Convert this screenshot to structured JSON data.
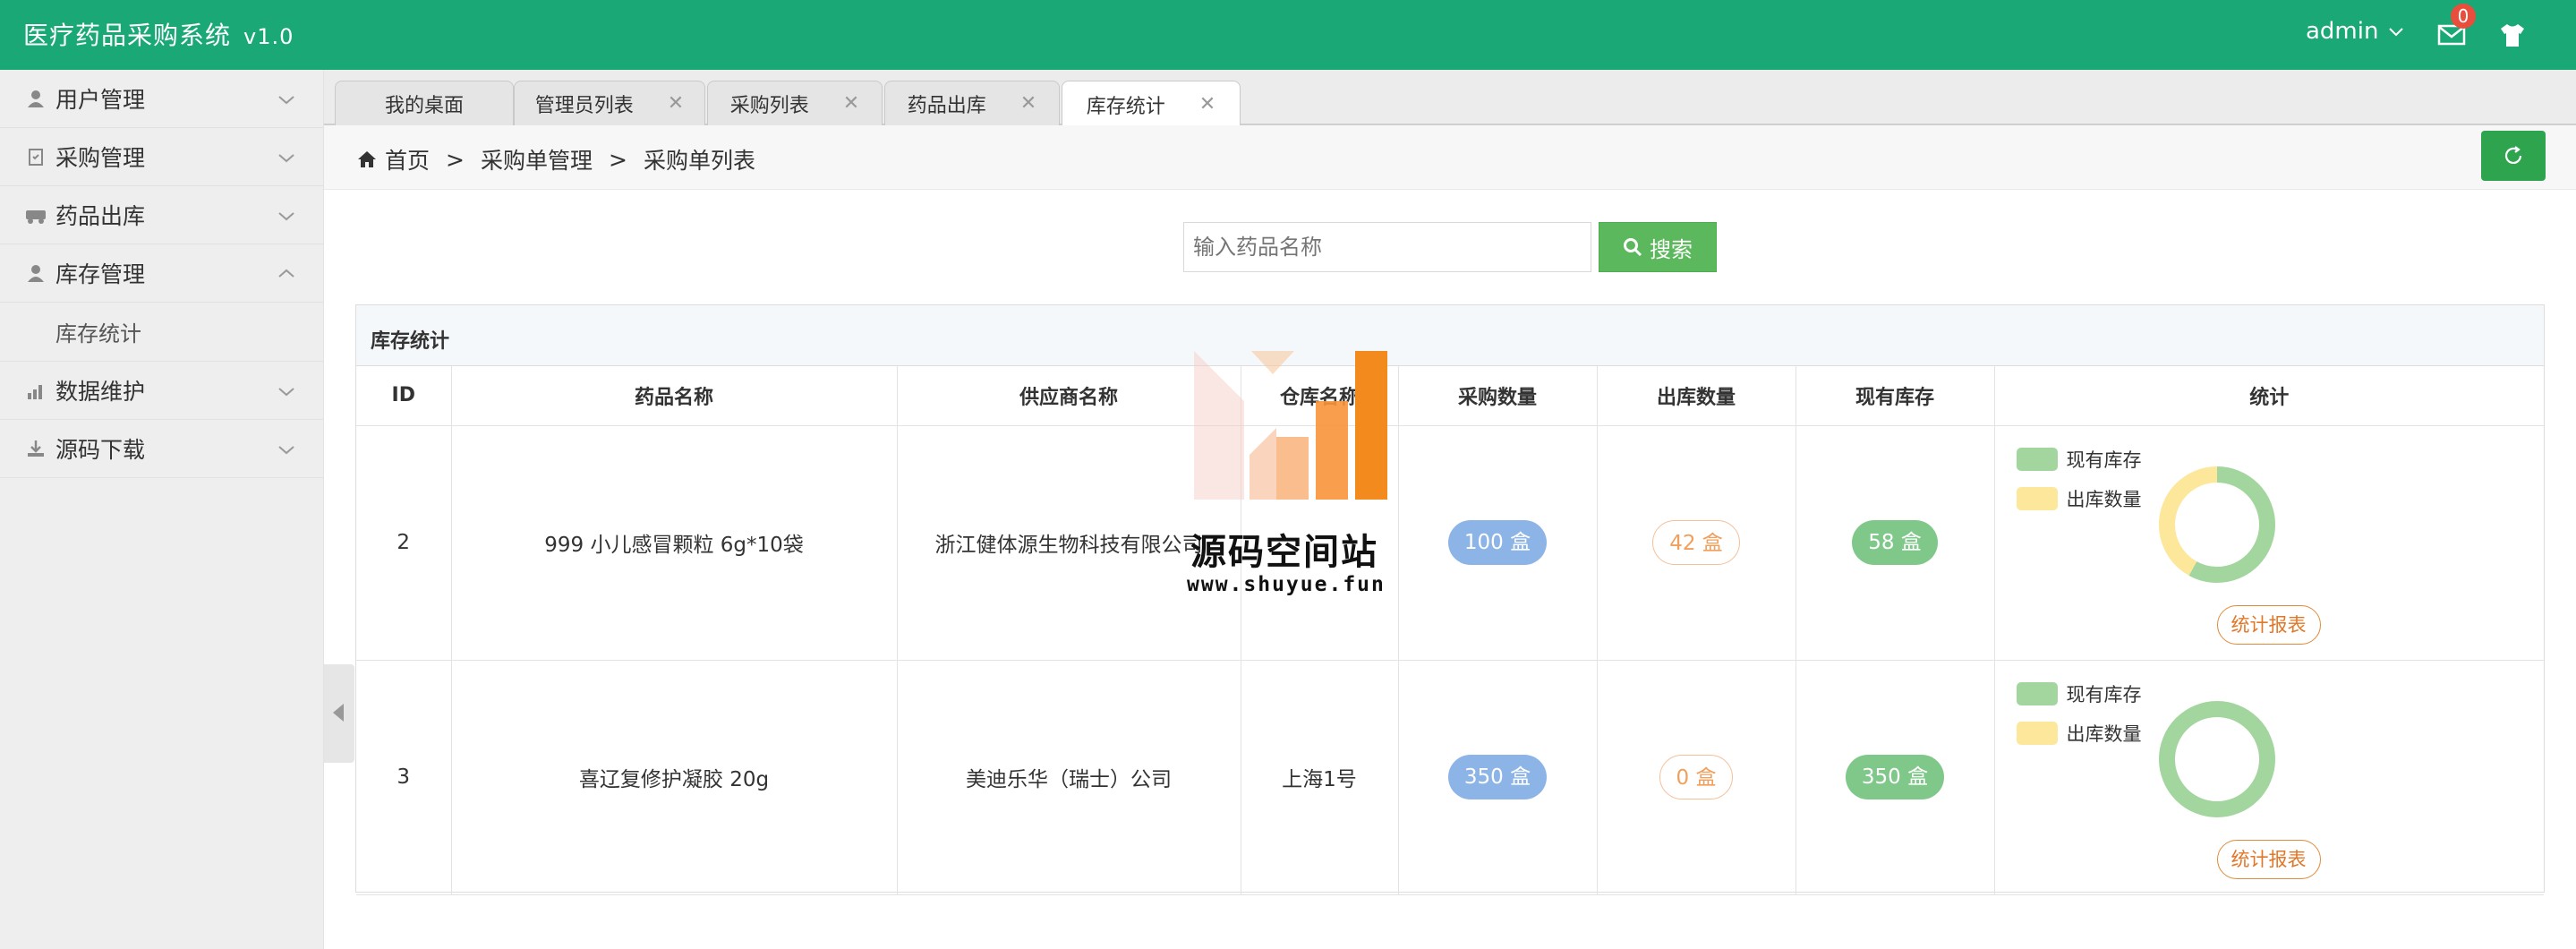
{
  "app": {
    "title": "医疗药品采购系统",
    "version": "v1.0"
  },
  "header": {
    "user": "admin",
    "mail_count": "0"
  },
  "sidebar": {
    "items": [
      {
        "label": "用户管理",
        "icon": "user-icon",
        "expanded": false
      },
      {
        "label": "采购管理",
        "icon": "clipboard-icon",
        "expanded": false
      },
      {
        "label": "药品出库",
        "icon": "truck-icon",
        "expanded": false
      },
      {
        "label": "库存管理",
        "icon": "user-icon",
        "expanded": true
      },
      {
        "label": "数据维护",
        "icon": "bar-chart-icon",
        "expanded": false
      },
      {
        "label": "源码下载",
        "icon": "download-icon",
        "expanded": false
      }
    ],
    "sub_items": [
      {
        "label": "库存统计"
      }
    ]
  },
  "tabs": [
    {
      "label": "我的桌面",
      "closable": false
    },
    {
      "label": "管理员列表",
      "closable": true
    },
    {
      "label": "采购列表",
      "closable": true
    },
    {
      "label": "药品出库",
      "closable": true
    },
    {
      "label": "库存统计",
      "closable": true,
      "active": true
    }
  ],
  "breadcrumb": [
    "首页",
    "采购单管理",
    "采购单列表"
  ],
  "breadcrumb_sep": ">",
  "search": {
    "placeholder": "输入药品名称",
    "button_label": "搜索"
  },
  "panel": {
    "title": "库存统计"
  },
  "table": {
    "columns": [
      "ID",
      "药品名称",
      "供应商名称",
      "仓库名称",
      "采购数量",
      "出库数量",
      "现有库存",
      "统计"
    ],
    "rows": [
      {
        "id": "2",
        "name": "999 小儿感冒颗粒 6g*10袋",
        "supplier": "浙江健体源生物科技有限公司",
        "warehouse": "",
        "purchased": "100 盒",
        "outbound": "42 盒",
        "stock": "58 盒",
        "stock_value": 58,
        "outbound_value": 42
      },
      {
        "id": "3",
        "name": "喜辽复修护凝胶 20g",
        "supplier": "美迪乐华（瑞士）公司",
        "warehouse": "上海1号",
        "purchased": "350 盒",
        "outbound": "0 盒",
        "stock": "350 盒",
        "stock_value": 350,
        "outbound_value": 0
      }
    ],
    "legend": [
      "现有库存",
      "出库数量"
    ],
    "report_label": "统计报表"
  },
  "colors": {
    "header": "#1aa877",
    "stock": "#a3d69e",
    "outbound": "#fce79b",
    "search_button": "#5cb85c",
    "refresh_button": "#2ea44f"
  },
  "watermark": {
    "title": "源码空间站",
    "url": "www.shuyue.fun"
  }
}
